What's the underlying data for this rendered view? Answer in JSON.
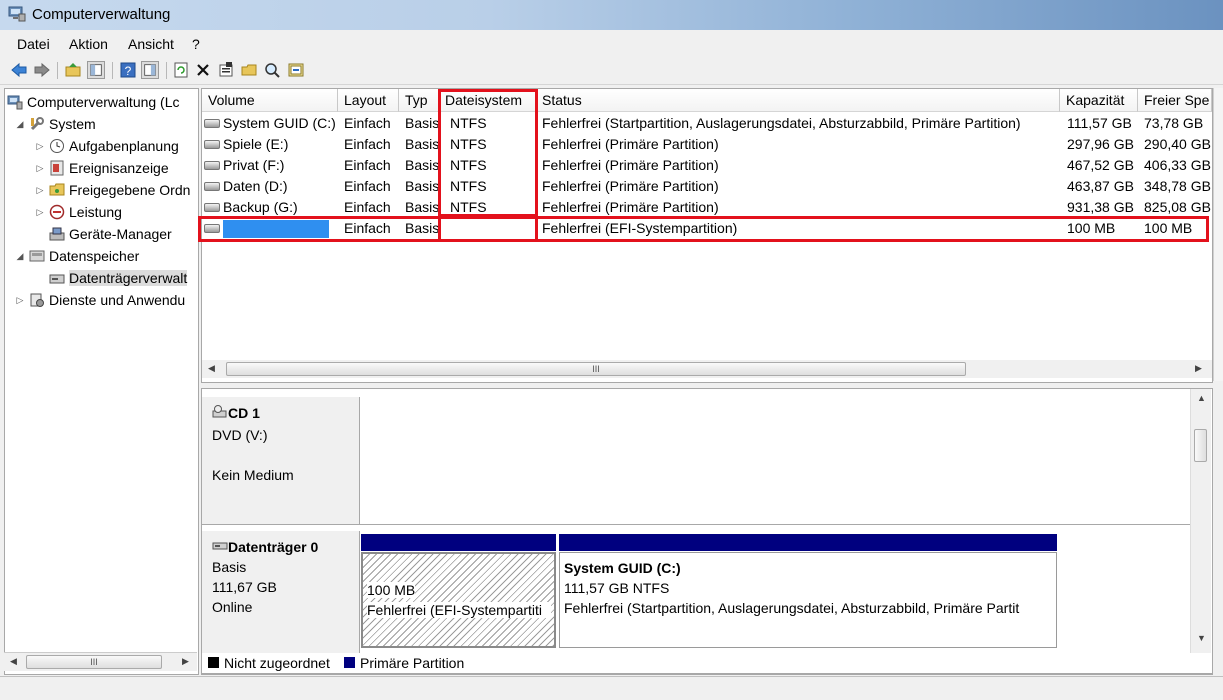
{
  "window": {
    "title": "Computerverwaltung"
  },
  "menu": [
    "Datei",
    "Aktion",
    "Ansicht",
    "?"
  ],
  "toolbar_icons": [
    "back-icon",
    "forward-icon",
    "up-folder-icon",
    "show-hide-tree-icon",
    "help-icon",
    "show-hide-action-icon",
    "refresh-icon",
    "delete-icon",
    "properties-icon",
    "open-icon",
    "search-icon",
    "export-icon"
  ],
  "tree": [
    {
      "label": "Computerverwaltung (Lc",
      "level": 0,
      "exp": "",
      "icon": "computer-icon"
    },
    {
      "label": "System",
      "level": 1,
      "exp": "◢",
      "icon": "tools-icon"
    },
    {
      "label": "Aufgabenplanung",
      "level": 2,
      "exp": "▷",
      "icon": "clock-icon"
    },
    {
      "label": "Ereignisanzeige",
      "level": 2,
      "exp": "▷",
      "icon": "event-viewer-icon"
    },
    {
      "label": "Freigegebene Ordn",
      "level": 2,
      "exp": "▷",
      "icon": "shared-folder-icon"
    },
    {
      "label": "Leistung",
      "level": 2,
      "exp": "▷",
      "icon": "performance-icon"
    },
    {
      "label": "Geräte-Manager",
      "level": 2,
      "exp": "",
      "icon": "device-manager-icon"
    },
    {
      "label": "Datenspeicher",
      "level": 1,
      "exp": "◢",
      "icon": "storage-icon"
    },
    {
      "label": "Datenträgerverwalt",
      "level": 2,
      "exp": "",
      "icon": "disk-management-icon",
      "selected": true
    },
    {
      "label": "Dienste und Anwendu",
      "level": 1,
      "exp": "▷",
      "icon": "services-icon"
    }
  ],
  "columns": [
    "Volume",
    "Layout",
    "Typ",
    "Dateisystem",
    "Status",
    "Kapazität",
    "Freier Spe"
  ],
  "volumes": [
    {
      "volume": "System GUID (C:)",
      "layout": "Einfach",
      "typ": "Basis",
      "fs": "NTFS",
      "status": "Fehlerfrei (Startpartition, Auslagerungsdatei, Absturzabbild, Primäre Partition)",
      "kap": "111,57 GB",
      "frei": "73,78 GB",
      "redacted": false
    },
    {
      "volume": "Spiele (E:)",
      "layout": "Einfach",
      "typ": "Basis",
      "fs": "NTFS",
      "status": "Fehlerfrei (Primäre Partition)",
      "kap": "297,96 GB",
      "frei": "290,40 GB",
      "redacted": false
    },
    {
      "volume": "Privat (F:)",
      "layout": "Einfach",
      "typ": "Basis",
      "fs": "NTFS",
      "status": "Fehlerfrei (Primäre Partition)",
      "kap": "467,52 GB",
      "frei": "406,33 GB",
      "redacted": false
    },
    {
      "volume": "Daten (D:)",
      "layout": "Einfach",
      "typ": "Basis",
      "fs": "NTFS",
      "status": "Fehlerfrei (Primäre Partition)",
      "kap": "463,87 GB",
      "frei": "348,78 GB",
      "redacted": false
    },
    {
      "volume": "Backup (G:)",
      "layout": "Einfach",
      "typ": "Basis",
      "fs": "NTFS",
      "status": "Fehlerfrei (Primäre Partition)",
      "kap": "931,38 GB",
      "frei": "825,08 GB",
      "redacted": false
    },
    {
      "volume": "",
      "layout": "Einfach",
      "typ": "Basis",
      "fs": "",
      "status": "Fehlerfrei (EFI-Systempartition)",
      "kap": "100 MB",
      "frei": "100 MB",
      "redacted": true
    }
  ],
  "list_hscroll_grip": "III",
  "tree_hscroll_grip": "III",
  "cd": {
    "name": "CD 1",
    "type": "DVD (V:)",
    "media": "Kein Medium"
  },
  "disk0": {
    "name": "Datenträger 0",
    "type": "Basis",
    "size": "111,67 GB",
    "state": "Online",
    "efi": {
      "size": "100 MB",
      "status": "Fehlerfrei (EFI-Systempartiti"
    },
    "system": {
      "name": "System GUID  (C:)",
      "size": "111,57 GB NTFS",
      "status": "Fehlerfrei (Startpartition, Auslagerungsdatei, Absturzabbild, Primäre Partit"
    }
  },
  "legend": [
    {
      "label": "Nicht zugeordnet",
      "color": "#000000"
    },
    {
      "label": "Primäre Partition",
      "color": "#00007f"
    }
  ],
  "colors": {
    "highlight": "#e3111c",
    "primary_partition": "#00007f",
    "redaction": "#2f8ff0"
  }
}
